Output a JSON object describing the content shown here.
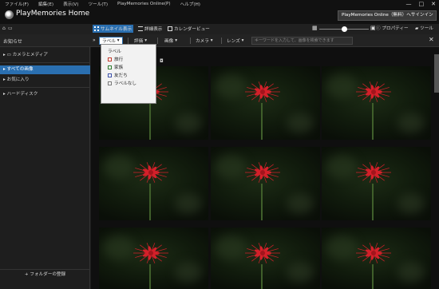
{
  "menubar": {
    "items": [
      "ファイル(F)",
      "編集(E)",
      "表示(V)",
      "ツール(T)",
      "PlayMemories Online(P)",
      "ヘルプ(H)"
    ],
    "window_controls": [
      "—",
      "□",
      "✕"
    ]
  },
  "header": {
    "app_title": "PlayMemories Home",
    "online_button": "PlayMemories Online（無料）へサインイン"
  },
  "toolbar": {
    "thumbnail_view": "サムネイル表示",
    "detail_view": "詳細表示",
    "calendar_view": "カレンダービュー",
    "properties": "プロパティー",
    "tools": "ツール"
  },
  "filters": {
    "label": "ラベル",
    "rating": "評価",
    "image": "画像",
    "camera": "カメラ",
    "lens": "レンズ",
    "search_placeholder": "キーワードを入力して、画像を検索できます"
  },
  "sidebar": {
    "notice": "お知らせ",
    "items": [
      {
        "label": "カメラとメディア"
      },
      {
        "label": "すべての画像",
        "selected": true
      },
      {
        "label": "お気に入り"
      },
      {
        "label": "ハードディスク"
      }
    ],
    "add_folder": "+ フォルダーの登録"
  },
  "label_dropdown": {
    "title": "ラベル",
    "options": [
      {
        "label": "旅行",
        "color": "#c0392b"
      },
      {
        "label": "家族",
        "color": "#2f7a2f"
      },
      {
        "label": "友だち",
        "color": "#3a4fa8"
      },
      {
        "label": "ラベルなし",
        "color": "#777777"
      }
    ]
  },
  "colors": {
    "accent": "#2a6fb0",
    "flower": "#d4202a"
  },
  "thumbnails": {
    "count": 9,
    "subject": "red spider lily"
  }
}
